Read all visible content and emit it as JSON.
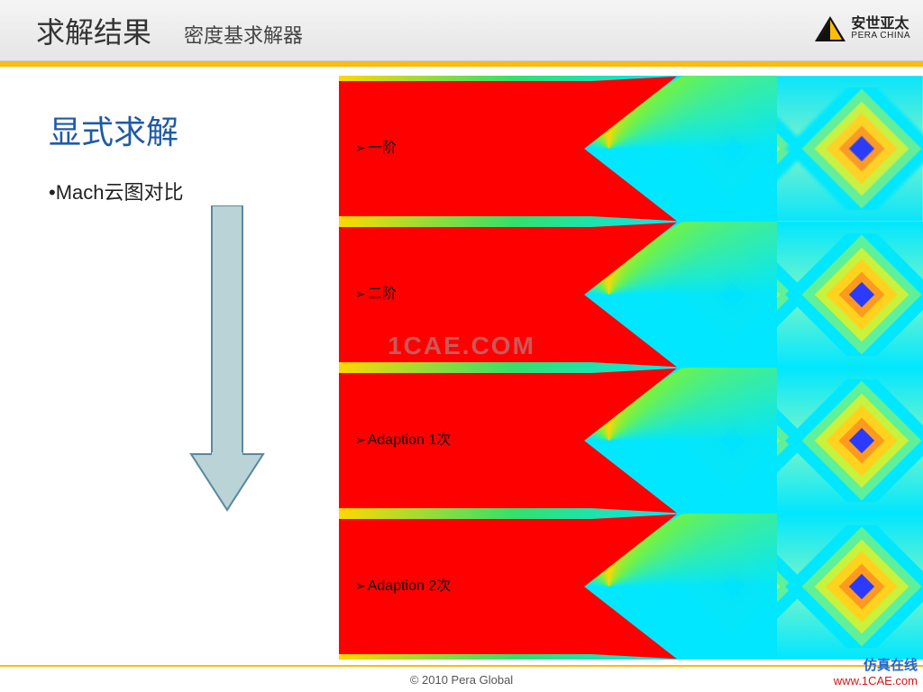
{
  "header": {
    "title": "求解结果",
    "subtitle": "密度基求解器",
    "logo": {
      "cn": "安世亚太",
      "en": "PERA CHINA"
    }
  },
  "left": {
    "heading": "显式求解",
    "bullet_prefix": "•",
    "bullet": "Mach云图对比"
  },
  "rows": [
    {
      "label": "一阶"
    },
    {
      "label": "二阶"
    },
    {
      "label": "Adaption 1次"
    },
    {
      "label": "Adaption 2次"
    }
  ],
  "watermark_center": "1CAE.COM",
  "footer": {
    "copyright": "© 2010 Pera Global"
  },
  "corner": {
    "cn": "仿真在线",
    "url": "www.1CAE.com"
  }
}
